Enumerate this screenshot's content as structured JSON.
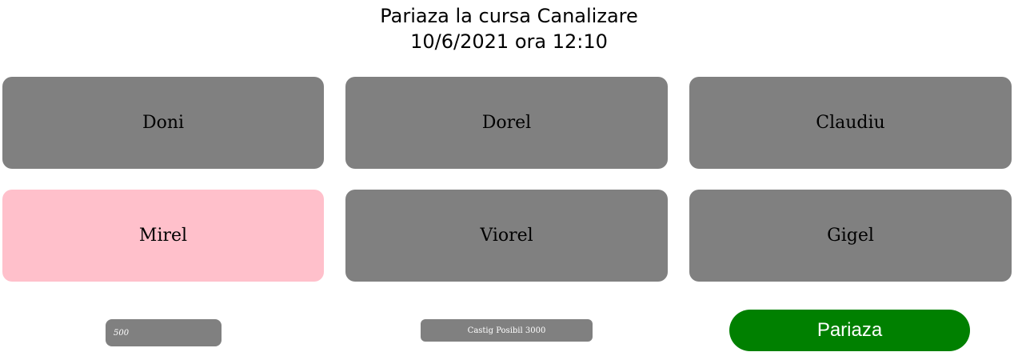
{
  "header": {
    "title": "Pariaza la cursa Canalizare",
    "datetime": "10/6/2021 ora 12:10"
  },
  "racers": [
    {
      "name": "Doni",
      "selected": false
    },
    {
      "name": "Dorel",
      "selected": false
    },
    {
      "name": "Claudiu",
      "selected": false
    },
    {
      "name": "Mirel",
      "selected": true
    },
    {
      "name": "Viorel",
      "selected": false
    },
    {
      "name": "Gigel",
      "selected": false
    }
  ],
  "bet": {
    "amount_value": "500",
    "possible_win_label": "Castig Posibil 3000",
    "button_label": "Pariaza"
  },
  "colors": {
    "tile": "#808080",
    "tile_selected": "#ffc0cb",
    "button": "#008000"
  }
}
